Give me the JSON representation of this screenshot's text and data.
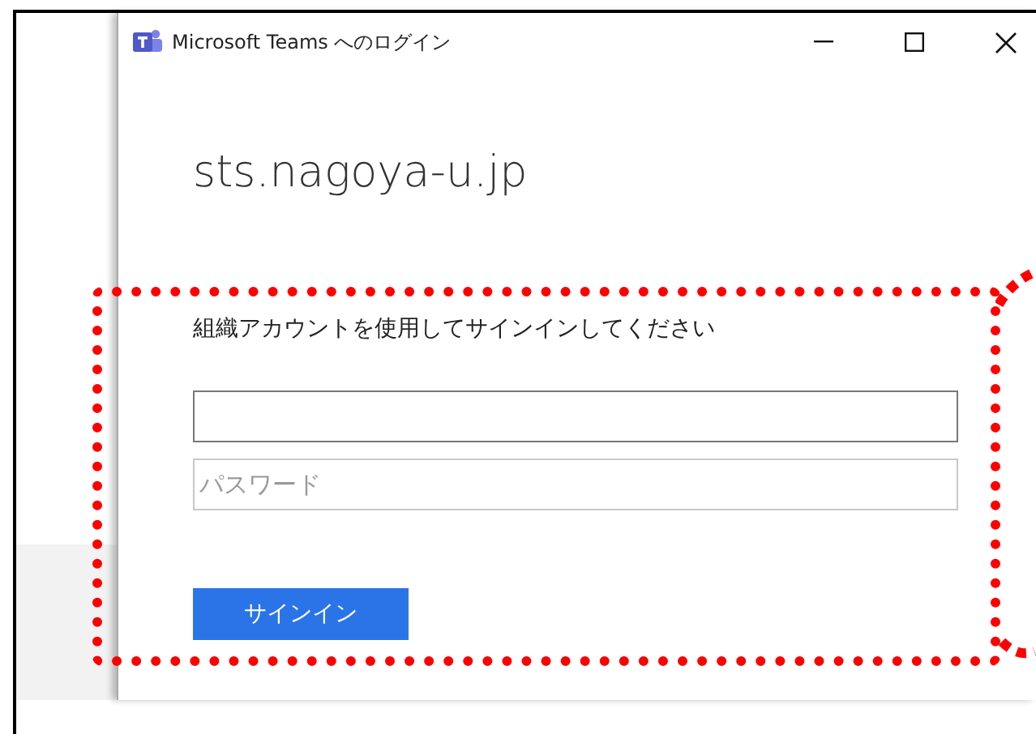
{
  "window": {
    "title": "Microsoft Teams へのログイン"
  },
  "login": {
    "domain": "sts.nagoya-u.jp",
    "prompt": "組織アカウントを使用してサインインしてください",
    "fields": [
      {
        "kind": "text"
      },
      {
        "kind": "password",
        "placeholder": "パスワード"
      }
    ],
    "button": "サインイン"
  }
}
